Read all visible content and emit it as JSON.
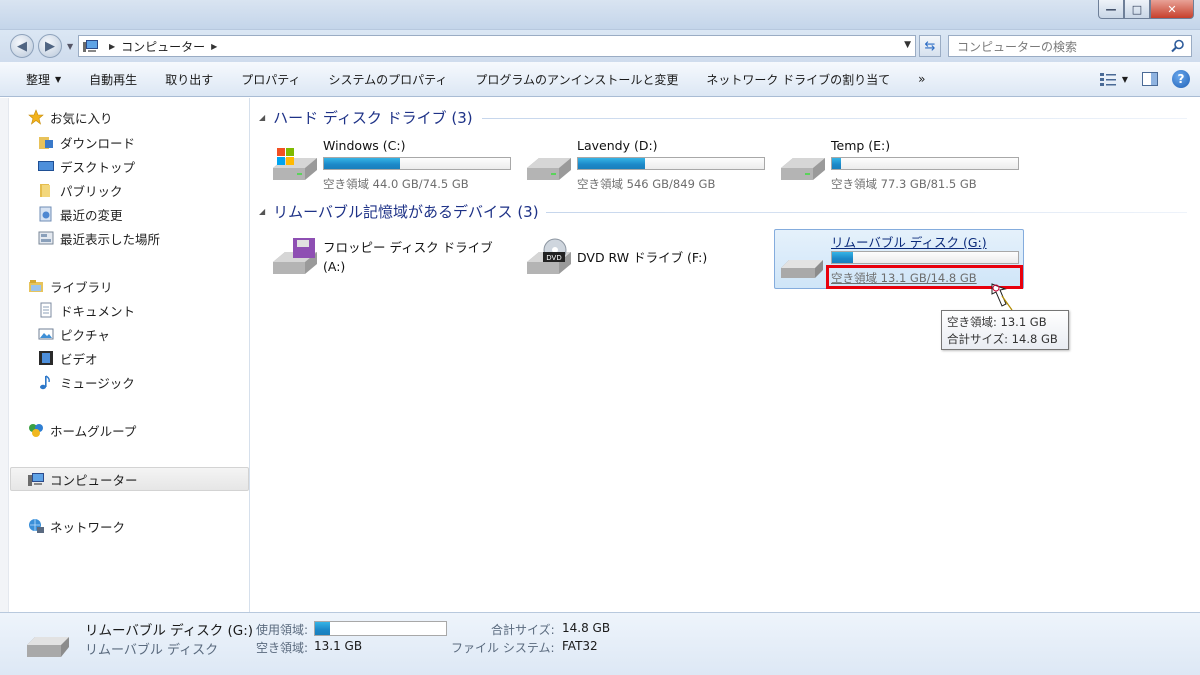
{
  "window": {
    "minimize_glyph": "—",
    "maximize_glyph": "□",
    "close_glyph": "✕"
  },
  "address": {
    "crumb": "コンピューター",
    "search_placeholder": "コンピューターの検索"
  },
  "toolbar": {
    "items": [
      "整理",
      "自動再生",
      "取り出す",
      "プロパティ",
      "システムのプロパティ",
      "プログラムのアンインストールと変更",
      "ネットワーク ドライブの割り当て",
      "»"
    ]
  },
  "sidebar": {
    "favorites": "お気に入り",
    "favorites_items": [
      "ダウンロード",
      "デスクトップ",
      "パブリック",
      "最近の変更",
      "最近表示した場所"
    ],
    "libraries": "ライブラリ",
    "library_items": [
      "ドキュメント",
      "ピクチャ",
      "ビデオ",
      "ミュージック"
    ],
    "homegroup": "ホームグループ",
    "computer": "コンピューター",
    "network": "ネットワーク"
  },
  "groups": {
    "hdd_header": "ハード ディスク ドライブ (3)",
    "removable_header": "リムーバブル記憶域があるデバイス (3)"
  },
  "drives": [
    {
      "name": "Windows (C:)",
      "free_text": "空き領域 44.0 GB/74.5 GB",
      "used_fraction": 0.41
    },
    {
      "name": "Lavendy (D:)",
      "free_text": "空き領域 546 GB/849 GB",
      "used_fraction": 0.36
    },
    {
      "name": "Temp (E:)",
      "free_text": "空き領域 77.3 GB/81.5 GB",
      "used_fraction": 0.05
    }
  ],
  "devices": [
    {
      "name_line1": "フロッピー ディスク ドライブ",
      "name_line2": "(A:)"
    },
    {
      "name_line1": "DVD RW ドライブ (F:)"
    },
    {
      "name": "リムーバブル ディスク (G:)",
      "free_text": "空き領域 13.1 GB/14.8 GB",
      "used_fraction": 0.115
    }
  ],
  "tooltip": {
    "line1": "空き領域: 13.1 GB",
    "line2": "合計サイズ: 14.8 GB"
  },
  "details": {
    "title": "リムーバブル ディスク (G:)",
    "subtitle": "リムーバブル ディスク",
    "used_label": "使用領域:",
    "used_fraction": 0.115,
    "free_label": "空き領域:",
    "free_value": "13.1 GB",
    "total_label": "合計サイズ:",
    "total_value": "14.8 GB",
    "fs_label": "ファイル システム:",
    "fs_value": "FAT32"
  },
  "colors": {
    "bar_fill": "#1c88c8",
    "highlight_box": "#e8000c",
    "group_header": "#1e3287"
  }
}
